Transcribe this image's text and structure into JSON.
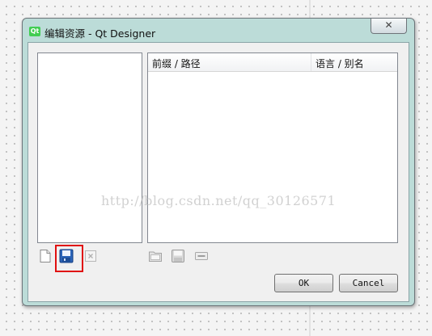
{
  "window": {
    "title": "编辑资源 - Qt Designer",
    "app_icon_text": "Qt",
    "close_symbol": "✕"
  },
  "resource_table": {
    "columns": [
      "前缀 / 路径",
      "语言 / 别名"
    ]
  },
  "watermark": "http://blog.csdn.net/qq_30126571",
  "left_toolbar": {
    "icons": [
      "new-file-icon",
      "save-icon",
      "remove-file-icon"
    ],
    "highlighted": "save-icon",
    "highlight_color": "#e01010"
  },
  "right_toolbar": {
    "icons": [
      "add-folder-icon",
      "save-icon",
      "minus-icon"
    ]
  },
  "buttons": {
    "ok": "OK",
    "cancel": "Cancel"
  }
}
